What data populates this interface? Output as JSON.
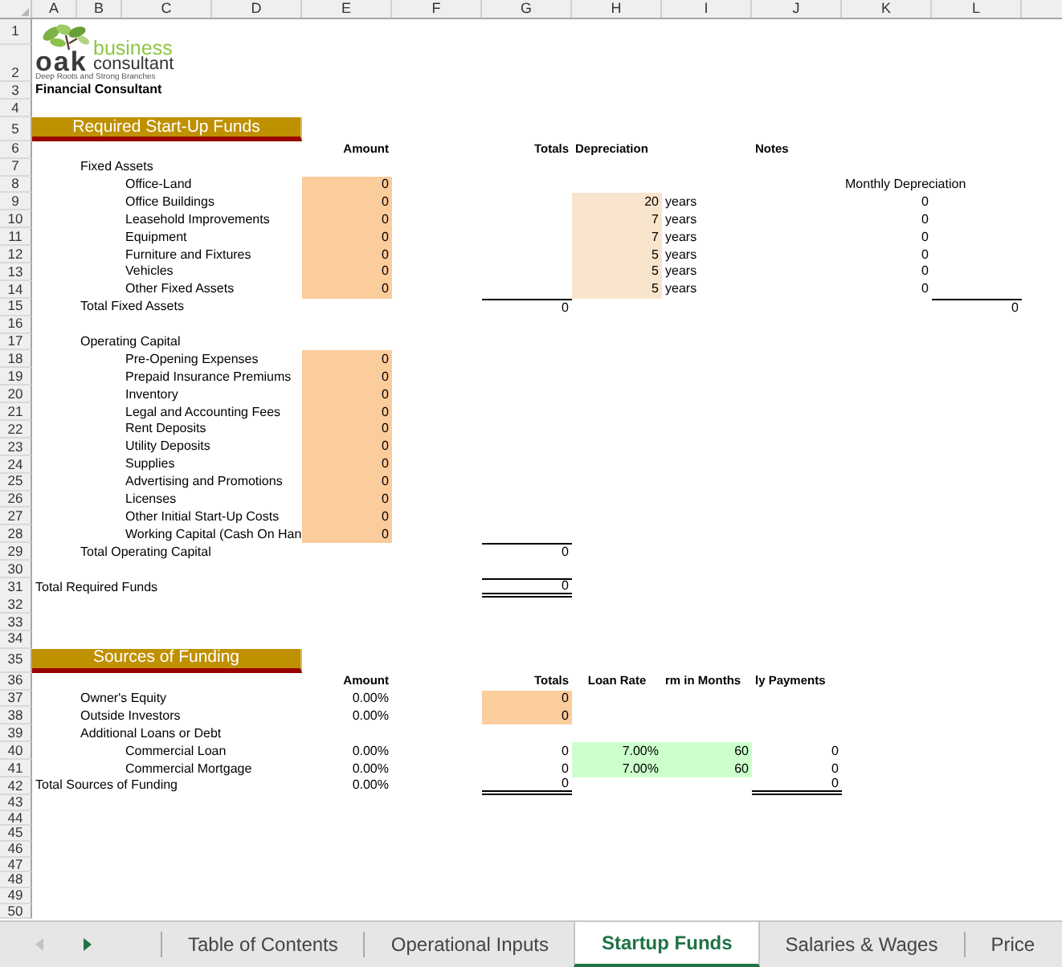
{
  "column_headers": [
    "A",
    "B",
    "C",
    "D",
    "E",
    "F",
    "G",
    "H",
    "I",
    "J",
    "K",
    "L"
  ],
  "row_numbers": [
    "1",
    "2",
    "3",
    "4",
    "5",
    "6",
    "7",
    "8",
    "9",
    "10",
    "11",
    "12",
    "13",
    "14",
    "15",
    "16",
    "17",
    "18",
    "19",
    "20",
    "21",
    "22",
    "23",
    "24",
    "25",
    "26",
    "27",
    "28",
    "29",
    "30",
    "31",
    "32",
    "33",
    "34",
    "35",
    "36",
    "37",
    "38",
    "39",
    "40",
    "41",
    "42",
    "43",
    "44",
    "45",
    "46",
    "47",
    "48",
    "49",
    "50"
  ],
  "logo": {
    "wordmark": "oak",
    "line_1": "business",
    "line_2": "consultant",
    "tagline": "Deep Roots and Strong Branches"
  },
  "company": "Financial Consultant",
  "required_funds": {
    "title": "Required Start-Up Funds",
    "headings": {
      "amount": "Amount",
      "totals": "Totals",
      "depreciation": "Depreciation",
      "notes": "Notes"
    },
    "fixed_assets": {
      "label": "Fixed Assets",
      "monthly_heading": "Monthly Depreciation",
      "items": [
        {
          "label": "Office-Land",
          "amount": "0"
        },
        {
          "label": "Office Buildings",
          "amount": "0",
          "years": "20",
          "unit": "years",
          "monthly": "0"
        },
        {
          "label": "Leasehold Improvements",
          "amount": "0",
          "years": "7",
          "unit": "years",
          "monthly": "0"
        },
        {
          "label": "Equipment",
          "amount": "0",
          "years": "7",
          "unit": "years",
          "monthly": "0"
        },
        {
          "label": "Furniture and Fixtures",
          "amount": "0",
          "years": "5",
          "unit": "years",
          "monthly": "0"
        },
        {
          "label": "Vehicles",
          "amount": "0",
          "years": "5",
          "unit": "years",
          "monthly": "0"
        },
        {
          "label": "Other Fixed Assets",
          "amount": "0",
          "years": "5",
          "unit": "years",
          "monthly": "0"
        }
      ],
      "total": {
        "label": "Total Fixed Assets",
        "value": "0",
        "monthly": "0"
      }
    },
    "operating_capital": {
      "label": "Operating Capital",
      "items": [
        {
          "label": "Pre-Opening Expenses",
          "amount": "0"
        },
        {
          "label": "Prepaid Insurance Premiums",
          "amount": "0"
        },
        {
          "label": "Inventory",
          "amount": "0"
        },
        {
          "label": "Legal and Accounting Fees",
          "amount": "0"
        },
        {
          "label": "Rent Deposits",
          "amount": "0"
        },
        {
          "label": "Utility Deposits",
          "amount": "0"
        },
        {
          "label": "Supplies",
          "amount": "0"
        },
        {
          "label": "Advertising and Promotions",
          "amount": "0"
        },
        {
          "label": "Licenses",
          "amount": "0"
        },
        {
          "label": "Other Initial Start-Up Costs",
          "amount": "0"
        },
        {
          "label": "Working Capital (Cash On Han",
          "amount": "0"
        }
      ],
      "total": {
        "label": "Total Operating Capital",
        "value": "0"
      }
    },
    "total": {
      "label": "Total Required Funds",
      "value": "0"
    }
  },
  "sources_of_funding": {
    "title": "Sources of Funding",
    "headings": {
      "amount": "Amount",
      "totals": "Totals",
      "loan_rate": "Loan Rate",
      "term": "rm in Months",
      "payments": "ly Payments"
    },
    "items": [
      {
        "label": "Owner's Equity",
        "share": "0.00%",
        "value": "0"
      },
      {
        "label": "Outside Investors",
        "share": "0.00%",
        "value": "0"
      }
    ],
    "loans": {
      "label": "Additional Loans or Debt",
      "items": [
        {
          "label": "Commercial Loan",
          "share": "0.00%",
          "value": "0",
          "rate": "7.00%",
          "term": "60",
          "payment": "0"
        },
        {
          "label": "Commercial Mortgage",
          "share": "0.00%",
          "value": "0",
          "rate": "7.00%",
          "term": "60",
          "payment": "0"
        }
      ]
    },
    "total": {
      "label": "Total Sources of Funding",
      "share": "0.00%",
      "value": "0",
      "payment": "0"
    }
  },
  "tab_scroll": [
    {
      "kind": "previous",
      "disabled": true
    },
    {
      "kind": "next",
      "disabled": false
    }
  ],
  "sheet_tabs": [
    {
      "label": "Table of Contents",
      "selected": false
    },
    {
      "label": "Operational Inputs",
      "selected": false
    },
    {
      "label": "Startup Funds",
      "selected": true
    },
    {
      "label": "Salaries & Wages",
      "selected": false
    },
    {
      "label": "Price",
      "selected": false
    }
  ]
}
